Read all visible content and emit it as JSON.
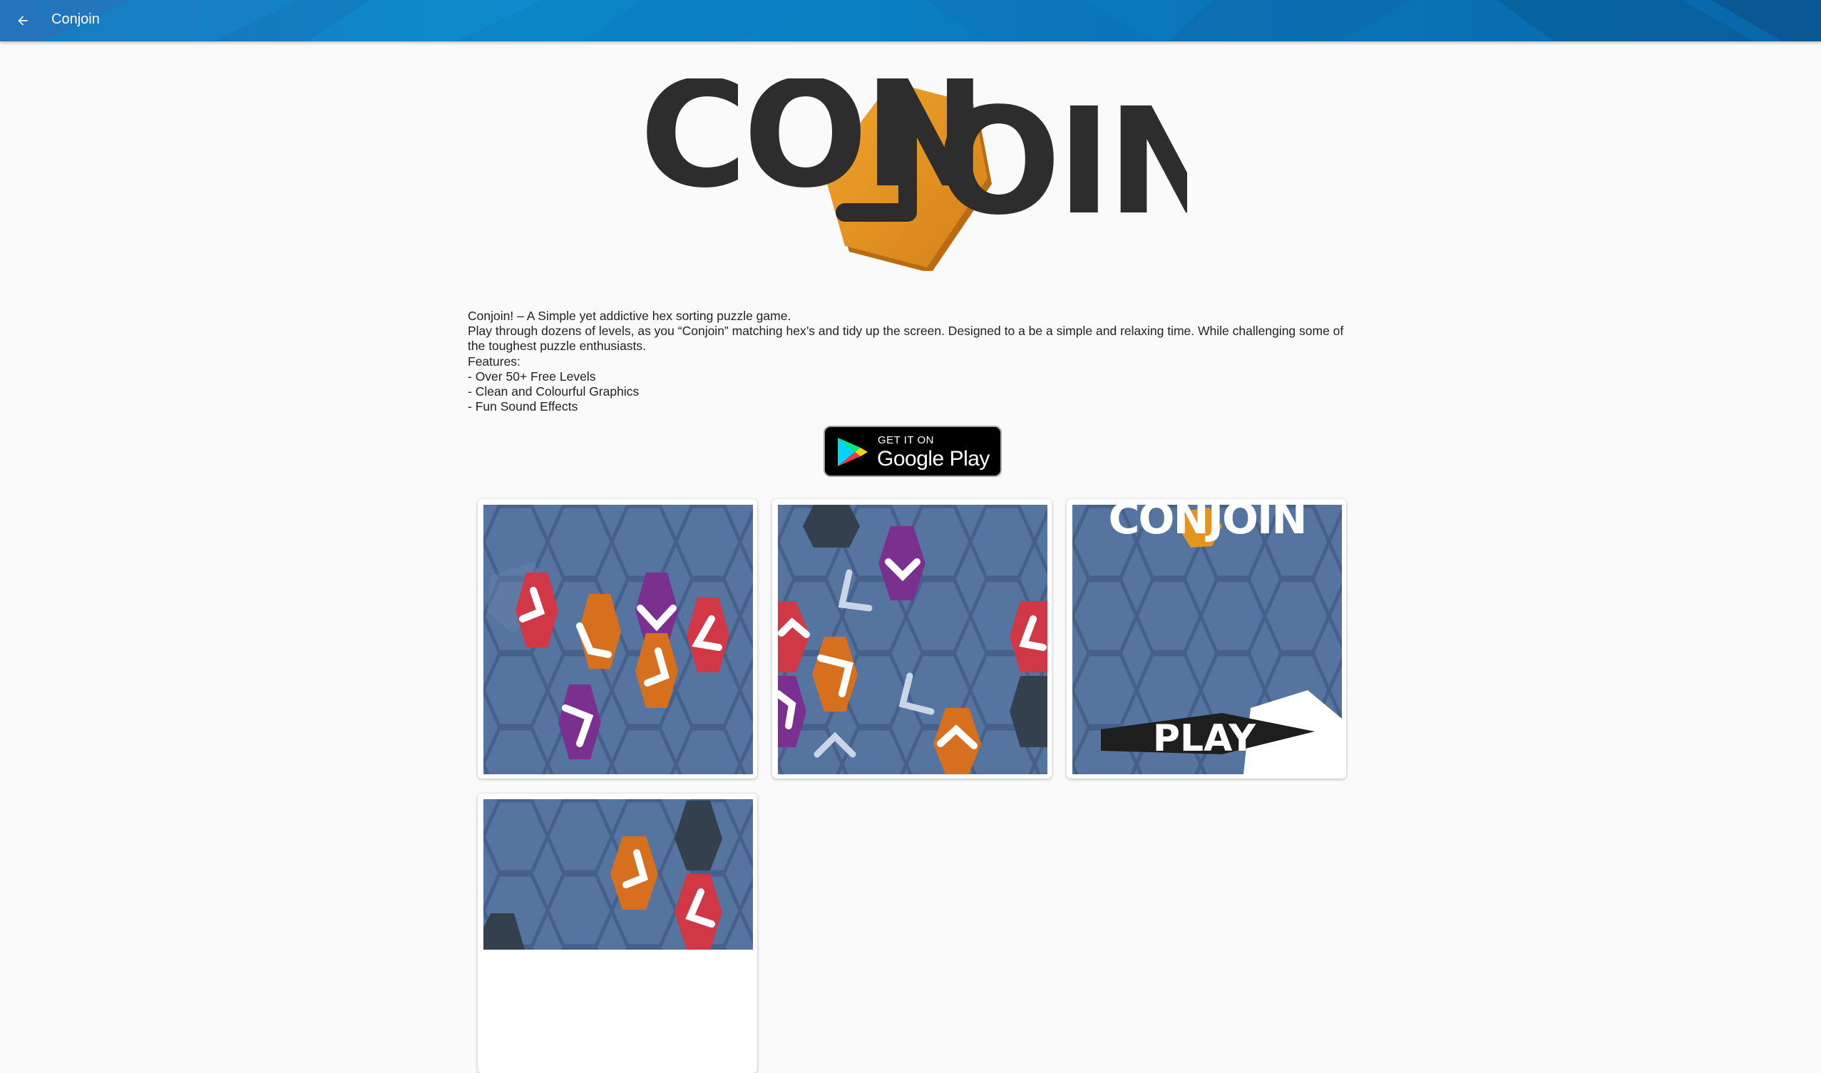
{
  "appbar": {
    "title": "Conjoin",
    "back_icon": "arrow-back-icon"
  },
  "logo": {
    "text_left": "CON",
    "text_right": "OIN",
    "hex_color": "#e49521",
    "letter_color": "#2d2d2d"
  },
  "description": {
    "lines": [
      "Conjoin! – A Simple yet addictive hex sorting puzzle game.",
      "Play through dozens of levels, as you “Conjoin” matching hex’s and tidy up the screen. Designed to a be a simple and relaxing time. While challenging some of the toughest puzzle enthusiasts.",
      "Features:",
      "- Over 50+ Free Levels",
      "- Clean and Colourful Graphics",
      "- Fun Sound Effects"
    ]
  },
  "store_badge": {
    "small_text": "GET IT ON",
    "big_text": "Google Play"
  },
  "screenshots": {
    "count": 4,
    "shot3": {
      "logo_text": "CONJOIN",
      "play_label": "PLAY"
    }
  },
  "colors": {
    "board": "#5574a0",
    "tile_red": "#d03846",
    "tile_orange": "#d7701e",
    "tile_purple": "#7b2f8f",
    "tile_dark": "#34404d"
  }
}
